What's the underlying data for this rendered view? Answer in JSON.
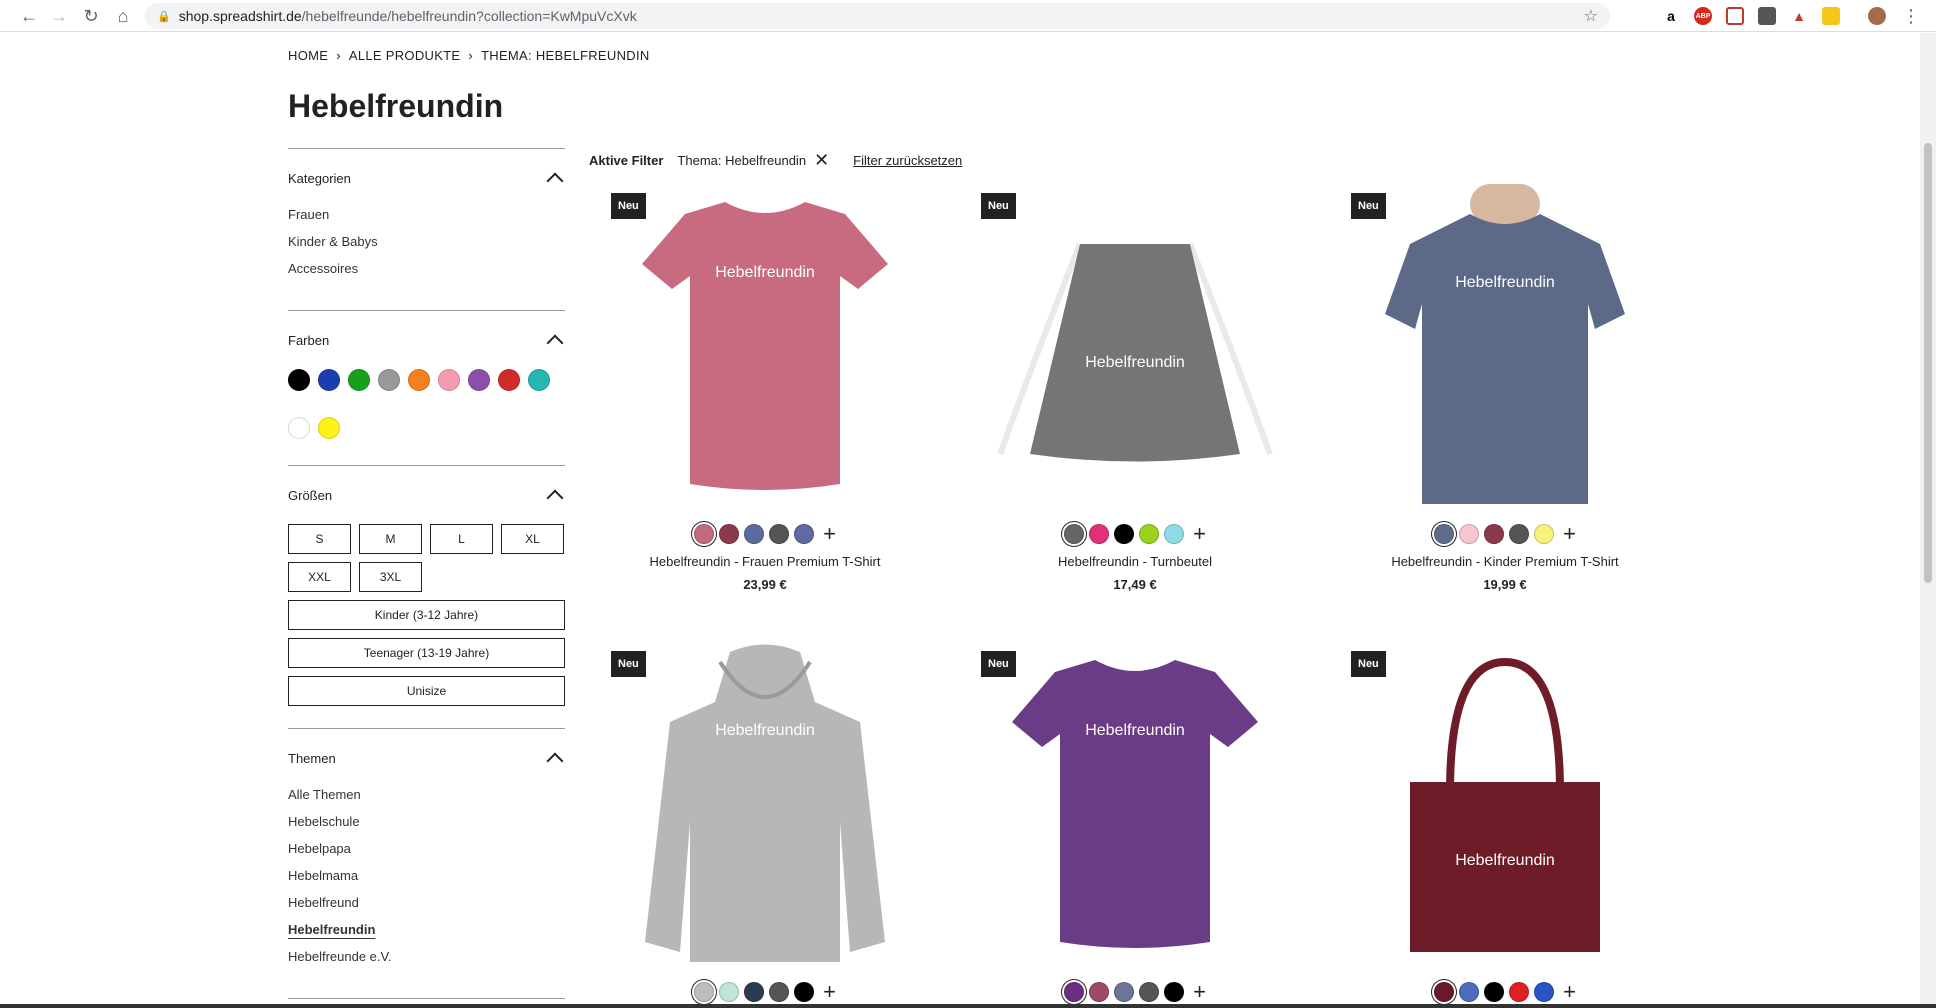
{
  "browser": {
    "url_host": "shop.spreadshirt.de",
    "url_path": "/hebelfreunde/hebelfreundin?collection=KwMpuVcXvk"
  },
  "breadcrumb": [
    "HOME",
    "ALLE PRODUKTE",
    "THEMA: HEBELFREUNDIN"
  ],
  "page_title": "Hebelfreundin",
  "sidebar": {
    "categories": {
      "title": "Kategorien",
      "items": [
        "Frauen",
        "Kinder & Babys",
        "Accessoires"
      ]
    },
    "colors": {
      "title": "Farben",
      "items": [
        "#000000",
        "#1a3db0",
        "#16a01c",
        "#999999",
        "#f5801e",
        "#f59bb0",
        "#8b4fab",
        "#d02b2b",
        "#26b7b4",
        "#ffffff",
        "#fff21a"
      ]
    },
    "sizes": {
      "title": "Größen",
      "items": [
        "S",
        "M",
        "L",
        "XL",
        "XXL",
        "3XL"
      ],
      "wide": [
        "Kinder (3-12 Jahre)",
        "Teenager (13-19 Jahre)",
        "Unisize"
      ]
    },
    "themes": {
      "title": "Themen",
      "items": [
        "Alle Themen",
        "Hebelschule",
        "Hebelpapa",
        "Hebelmama",
        "Hebelfreund",
        "Hebelfreundin",
        "Hebelfreunde e.V."
      ],
      "active_index": 5
    }
  },
  "filters": {
    "label": "Aktive Filter",
    "tag": "Thema: Hebelfreundin",
    "reset": "Filter zurücksetzen"
  },
  "products": [
    {
      "badge": "Neu",
      "name": "Hebelfreundin - Frauen Premium T-Shirt",
      "price": "23,99 €",
      "print": "Hebelfreundin",
      "colors": [
        "#c46a7e",
        "#8a3a4c",
        "#5a6a9a",
        "#555555",
        "#5f6aa3"
      ],
      "selected": 0,
      "type": "tshirt",
      "item_color": "#c86b80"
    },
    {
      "badge": "Neu",
      "name": "Hebelfreundin - Turnbeutel",
      "price": "17,49 €",
      "print": "Hebelfreundin",
      "colors": [
        "#666666",
        "#e0307a",
        "#000000",
        "#9ad21e",
        "#8fdbe6"
      ],
      "selected": 0,
      "type": "bag",
      "item_color": "#737577"
    },
    {
      "badge": "Neu",
      "name": "Hebelfreundin - Kinder Premium T-Shirt",
      "price": "19,99 €",
      "print": "Hebelfreundin",
      "colors": [
        "#5e6d8e",
        "#f6c6cf",
        "#8a3a4c",
        "#555555",
        "#f7f07a"
      ],
      "selected": 0,
      "type": "kidshirt",
      "item_color": "#5c6a88"
    },
    {
      "badge": "Neu",
      "print": "Hebelfreundin",
      "colors": [
        "#bdbdbd",
        "#bfe6d4",
        "#2a3a52",
        "#555555",
        "#000000"
      ],
      "selected": 0,
      "type": "hoodie",
      "item_color": "#b7b7b7"
    },
    {
      "badge": "Neu",
      "print": "Hebelfreundin",
      "colors": [
        "#6a2f7e",
        "#9e4a63",
        "#6b7696",
        "#555555",
        "#000000"
      ],
      "selected": 0,
      "type": "tshirt2",
      "item_color": "#6b3c86"
    },
    {
      "badge": "Neu",
      "print": "Hebelfreundin",
      "colors": [
        "#6a1a26",
        "#4f6bc0",
        "#000000",
        "#e02020",
        "#2a55c8"
      ],
      "selected": 0,
      "type": "tote",
      "item_color": "#6e1c28"
    }
  ]
}
